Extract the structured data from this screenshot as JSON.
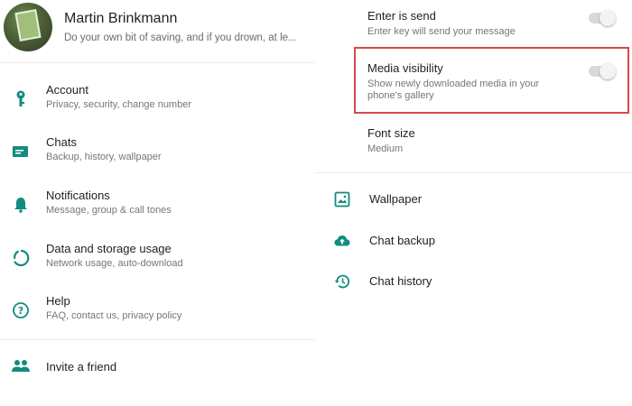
{
  "profile": {
    "name": "Martin Brinkmann",
    "status": "Do your own bit of saving, and if you drown, at le..."
  },
  "menu": [
    {
      "title": "Account",
      "subtitle": "Privacy, security, change number",
      "icon": "key-icon"
    },
    {
      "title": "Chats",
      "subtitle": "Backup, history, wallpaper",
      "icon": "chat-icon"
    },
    {
      "title": "Notifications",
      "subtitle": "Message, group & call tones",
      "icon": "bell-icon"
    },
    {
      "title": "Data and storage usage",
      "subtitle": "Network usage, auto-download",
      "icon": "data-usage-icon"
    },
    {
      "title": "Help",
      "subtitle": "FAQ, contact us, privacy policy",
      "icon": "help-icon"
    }
  ],
  "invite": {
    "title": "Invite a friend",
    "icon": "people-icon"
  },
  "chat_settings": {
    "enter_is_send": {
      "title": "Enter is send",
      "subtitle": "Enter key will send your message",
      "enabled": false
    },
    "media_visibility": {
      "title": "Media visibility",
      "subtitle_line1": "Show newly downloaded media in your",
      "subtitle_line2": "phone's gallery",
      "enabled": false
    },
    "font_size": {
      "title": "Font size",
      "value": "Medium"
    }
  },
  "chat_actions": [
    {
      "title": "Wallpaper",
      "icon": "wallpaper-icon"
    },
    {
      "title": "Chat backup",
      "icon": "cloud-upload-icon"
    },
    {
      "title": "Chat history",
      "icon": "history-icon"
    }
  ],
  "colors": {
    "accent": "#128c7e",
    "highlight_border": "#d4494b",
    "toggle_track": "#d9d9d9"
  }
}
